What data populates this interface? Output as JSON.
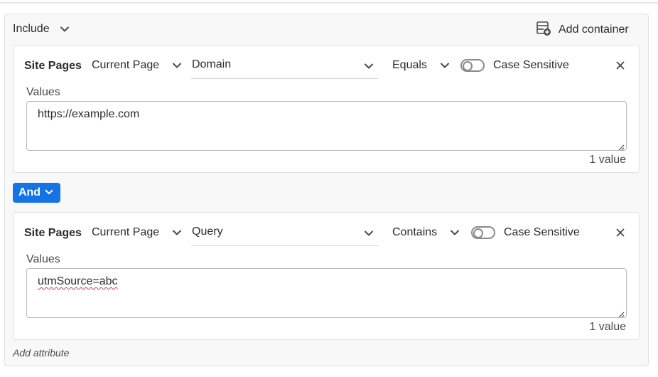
{
  "header": {
    "include_label": "Include",
    "add_container_label": "Add container"
  },
  "rules": [
    {
      "attribute": "Site Pages",
      "scope": "Current Page",
      "field": "Domain",
      "operator": "Equals",
      "case_sensitive_label": "Case Sensitive",
      "case_sensitive": false,
      "values_label": "Values",
      "value": "https://example.com",
      "value_count": "1 value"
    },
    {
      "attribute": "Site Pages",
      "scope": "Current Page",
      "field": "Query",
      "operator": "Contains",
      "case_sensitive_label": "Case Sensitive",
      "case_sensitive": false,
      "values_label": "Values",
      "value": "utmSource=abc",
      "value_count": "1 value"
    }
  ],
  "logic": {
    "operator_label": "And"
  },
  "footer": {
    "add_attribute_label": "Add attribute"
  },
  "colors": {
    "accent": "#1473e6",
    "spellcheck": "#d7373f",
    "text": "#2c2c2c"
  }
}
